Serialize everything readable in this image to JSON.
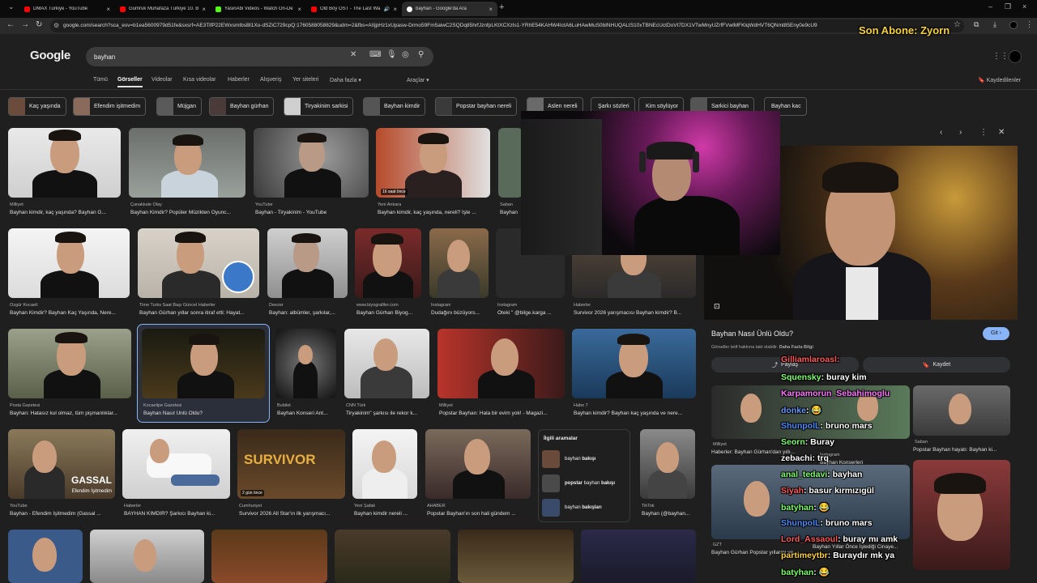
{
  "tabs": [
    {
      "title": "DMAX Turkiye - YouTube",
      "color": "#ff0000"
    },
    {
      "title": "Gümrük Muhafaza Türkiye 10. B",
      "color": "#ff0000"
    },
    {
      "title": "YasinAbi Videos - Watch On-De",
      "color": "#53fc18"
    },
    {
      "title": "Old Boy OST - The Last Wa",
      "color": "#ff0000"
    },
    {
      "title": "bayhan - Google'da Ara",
      "color": "#ffffff"
    }
  ],
  "address": {
    "url": "google.com/search?sca_esv=b1ea5600979d51fe&sxsrf=AE3TifP22EWxsmIbsBl1Xo-dSZiC729cpQ:1760588058829&udm=2&fbs=AIIjpHz1xUpasw-Drmo59Fm5aiwC2SQDq85hrfJznfpLKtXCXzIs1-YRhE54KAHW4IctA6LuHAwMuS0bINHUQALtS10xTBNEcUctDoVt7DX1VTwMnyUZrfFVwlMFKlqWdHVT6QNmt85Eny0e9cU9"
  },
  "overlay_title": "Son Abone: Zyorn",
  "google": {
    "logo": "Google",
    "query": "bayhan",
    "nav": [
      {
        "label": "Tümü"
      },
      {
        "label": "Görseller"
      },
      {
        "label": "Videolar"
      },
      {
        "label": "Kısa videolar"
      },
      {
        "label": "Haberler"
      },
      {
        "label": "Alışveriş"
      },
      {
        "label": "Yer siteleri"
      },
      {
        "label": "Daha fazla ▾"
      }
    ],
    "tools": "Araçlar ▾",
    "saved": "Kaydedilenler"
  },
  "chips": [
    {
      "label": "Kaç yaşında"
    },
    {
      "label": "Efendim işitmedim"
    },
    {
      "label": "Müjgan"
    },
    {
      "label": "Bayhan gürhan"
    },
    {
      "label": "Tiryakinim sarkisi"
    },
    {
      "label": "Bayhan kimdir"
    },
    {
      "label": "Popstar bayhan nereli"
    },
    {
      "label": "Aslen nereli"
    },
    {
      "label": "Şarkı sözleri"
    },
    {
      "label": "Kim söylüyor"
    },
    {
      "label": "Sarkici bayhan"
    },
    {
      "label": "Bayhan kac"
    }
  ],
  "results": [
    {
      "src": "Milliyet",
      "cap": "Bayhan kimdir, kaç yaşında? Bayhan G..."
    },
    {
      "src": "Çanakkale Olay",
      "cap": "Bayhan Kimdir? Popüler Müzikten Oyunc..."
    },
    {
      "src": "YouTube",
      "cap": "Bayhan - Tiryakinim - YouTube"
    },
    {
      "src": "Yeni Ankara",
      "cap": "Bayhan kimdir, kaç yaşında, nereli? İşte ..."
    },
    {
      "src": "Saban",
      "cap": "Bayhan"
    },
    {
      "src": "Özgür Kocaeli",
      "cap": "Bayhan Kimdir? Bayhan Kaç Yaşında, Nere..."
    },
    {
      "src": "Time Turks Saat Başı Güncel Haberler",
      "cap": "Bayhan Gürhan yıllar sonra itiraf etti: Hayat..."
    },
    {
      "src": "Deezer",
      "cap": "Bayhan: albümler, şarkılar,..."
    },
    {
      "src": "www.biyografiler.com",
      "cap": "Bayhan Gürhan Biyog..."
    },
    {
      "src": "Instagram",
      "cap": "Dudağını büzüyors..."
    },
    {
      "src": "Instagram",
      "cap": "Öteki \" @bilge.karga ..."
    },
    {
      "src": "Haberler",
      "cap": "Survivor 2026 yarışmacısı Bayhan kimdir? B..."
    },
    {
      "src": "Posta Gazetesi",
      "cap": "Bayhan: Hatasız kul olmaz, tüm pişmanlıklar..."
    },
    {
      "src": "Kocaelipe Gazetesi",
      "cap": "Bayhan Nasıl Ünlü Oldu?"
    },
    {
      "src": "Bubilet",
      "cap": "Bayhan Konseri Ant..."
    },
    {
      "src": "CNN Türk",
      "cap": "Tiryakinim\" şarkısı ile rekor k..."
    },
    {
      "src": "Milliyet",
      "cap": "Popstar Bayhan: Hala bir evim yok! - Magazi..."
    },
    {
      "src": "Habe 7",
      "cap": "Bayhan kimdir? Bayhan kaç yaşında ve nere..."
    },
    {
      "src": "YouTube",
      "cap": "Bayhan - Efendim İşitmedim (Gassal ..."
    },
    {
      "src": "Haberler",
      "cap": "BAYHAN KİMDİR? Şarkıcı Bayhan ki..."
    },
    {
      "src": "Cumhuriyet",
      "cap": "Survivor 2026 All Star'ın ilk yarışmacı..."
    },
    {
      "src": "Yeni Şafak",
      "cap": "Bayhan kimdir nereli ..."
    },
    {
      "src": "AHABER",
      "cap": "Popstar Bayhan'ın son hali gündem ..."
    },
    {
      "src": "TikTok",
      "cap": "Bayhan (@bayhan..."
    }
  ],
  "badges": {
    "time1": "16 saat önce",
    "time2": "2 gün önce",
    "gassal": "GASSAL",
    "gassal_sub": "Efendim İşitmedim",
    "survivor": "SURVIVOR"
  },
  "related": {
    "title": "İlgili aramalar",
    "items": [
      {
        "pre": "",
        "bold": "bakışı",
        "base": "bayhan "
      },
      {
        "pre": "popstar ",
        "bold": "bakışı",
        "base": "bayhan "
      },
      {
        "pre": "",
        "bold": "bakışları",
        "base": "bayhan "
      }
    ]
  },
  "panel": {
    "title": "Bayhan Nasıl Ünlü Oldu?",
    "go": "Git ›",
    "note": "Görseller telif hakkına tabi olabilir.",
    "note_link": "Daha Fazla Bilgi",
    "share": "Paylaş",
    "save": "Kaydet",
    "sub1_src": "Milliyet",
    "sub1_cap": "Haberler: Bayhan Gürhan'dan yıllı...",
    "sub2_src": "Instagram",
    "sub2_cap": "Bayhan Konserleri",
    "sub3_src": "Saban",
    "sub3_cap": "Popstar Bayhan hayatı: Bayhan ki...",
    "sub4_src": "GZT",
    "sub4_cap": "Bayhan Gürhan Popstar yıllarını ve...",
    "sub5_cap": "Bayhan Yıllar Önce İşlediği Cinaye..."
  },
  "chat": [
    {
      "user": "Gilliamlaroasl:",
      "msg": "",
      "color": "#ff5a5a"
    },
    {
      "user": "Squensky",
      "msg": ": buray kim",
      "color": "#7cff6b"
    },
    {
      "user": "Karpamorun_Sebahimoglu",
      "msg": "",
      "color": "#ff77ff"
    },
    {
      "user": "donke",
      "msg": ": 😂",
      "color": "#6699ff"
    },
    {
      "user": "ShunpolL",
      "msg": ": bruno mars",
      "color": "#4d8cff"
    },
    {
      "user": "Seorn",
      "msg": ": Buray",
      "color": "#7cff6b"
    },
    {
      "user": "zebachi",
      "msg": ": trq",
      "color": "#ffffff"
    },
    {
      "user": "anal_tedavi",
      "msg": ": bayhan",
      "color": "#7cff6b"
    },
    {
      "user": "Siyah",
      "msg": ": basur kırmızıgül",
      "color": "#ff5a5a"
    },
    {
      "user": "batyhan",
      "msg": ": 😂",
      "color": "#7cff6b"
    },
    {
      "user": "ShunpolL",
      "msg": ": bruno mars",
      "color": "#4d8cff"
    },
    {
      "user": "Lord_Assaoul",
      "msg": ": buray mı amk",
      "color": "#ff5a5a"
    },
    {
      "user": "partimeytbr",
      "msg": ": Buraydır mk ya",
      "color": "#ffd23f"
    },
    {
      "user": "batyhan",
      "msg": ": 😂",
      "color": "#7cff6b"
    }
  ]
}
